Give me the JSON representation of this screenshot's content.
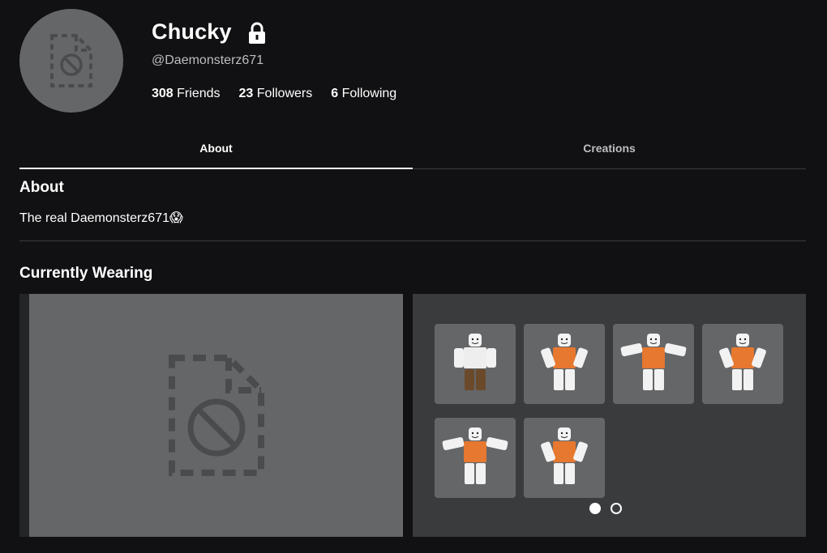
{
  "profile": {
    "display_name": "Chucky",
    "username": "@Daemonsterz671",
    "avatar_icon": "blocked-image-icon",
    "lock_icon": "lock-icon"
  },
  "stats": [
    {
      "count": "308",
      "label": "Friends"
    },
    {
      "count": "23",
      "label": "Followers"
    },
    {
      "count": "6",
      "label": "Following"
    }
  ],
  "tabs": [
    {
      "label": "About",
      "active": true
    },
    {
      "label": "Creations",
      "active": false
    }
  ],
  "about": {
    "title": "About",
    "text": "The real Daemonsterz671😱"
  },
  "wearing": {
    "title": "Currently Wearing",
    "items": [
      {
        "icon": "avatar-item-1"
      },
      {
        "icon": "avatar-item-2"
      },
      {
        "icon": "avatar-item-3"
      },
      {
        "icon": "avatar-item-4"
      },
      {
        "icon": "avatar-item-5"
      },
      {
        "icon": "avatar-item-6"
      }
    ],
    "page": 1,
    "page_count": 2
  },
  "colors": {
    "background": "#111113",
    "placeholder": "#656668",
    "panel": "#393b3d",
    "accent_torso": "#e6782f"
  }
}
